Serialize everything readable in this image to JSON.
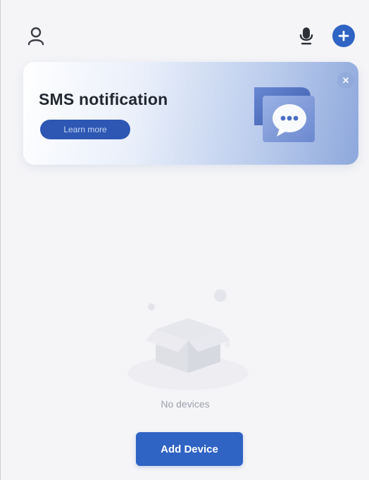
{
  "header": {
    "icons": [
      "user-icon",
      "microphone-icon",
      "plus-icon"
    ]
  },
  "banner": {
    "title": "SMS notification",
    "learn_more_label": "Learn more",
    "illustration": "chat-bubble-icon"
  },
  "empty_state": {
    "message": "No devices",
    "illustration": "empty-box-icon"
  },
  "actions": {
    "add_device_label": "Add Device"
  },
  "colors": {
    "accent": "#2f63c4",
    "banner_button": "#2d57b3",
    "background": "#f5f5f7"
  }
}
